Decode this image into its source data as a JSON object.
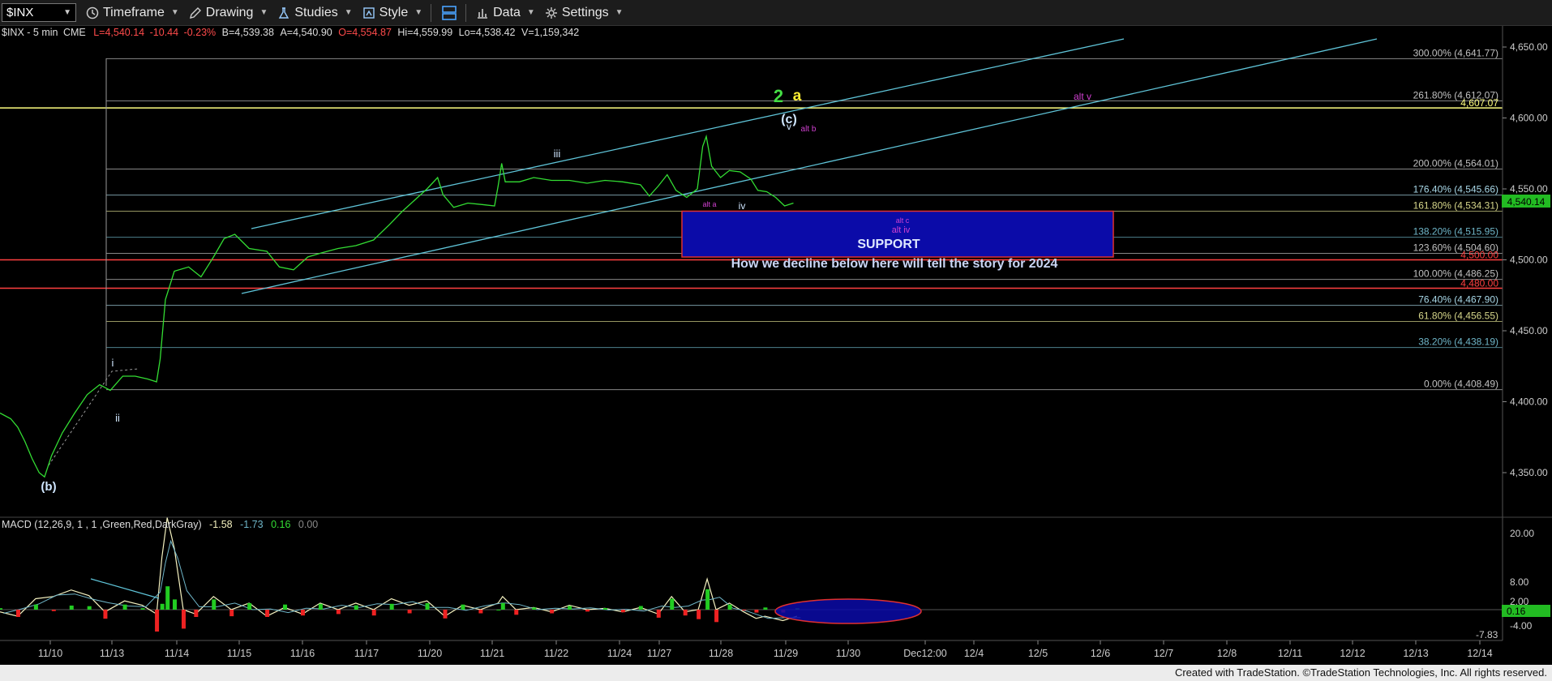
{
  "toolbar": {
    "symbol": "$INX",
    "timeframe": "Timeframe",
    "drawing": "Drawing",
    "studies": "Studies",
    "style": "Style",
    "data": "Data",
    "settings": "Settings"
  },
  "quote_line": {
    "symbol_interval": "$INX - 5 min",
    "exchange": "CME",
    "last": "L=4,540.14",
    "change": "-10.44",
    "change_pct": "-0.23%",
    "bid": "B=4,539.38",
    "ask": "A=4,540.90",
    "open": "O=4,554.87",
    "high": "Hi=4,559.99",
    "low": "Lo=4,538.42",
    "volume": "V=1,159,342"
  },
  "macd": {
    "label": "MACD (12,26,9, 1 , 1 ,Green,Red,DarkGray)",
    "v1": "-1.58",
    "v2": "-1.73",
    "v3": "0.16",
    "v4": "0.00",
    "axis": [
      "20.00",
      "8.00",
      "2.00",
      "-4.00"
    ],
    "last_tag": "0.16",
    "low_tag": "-7.83"
  },
  "footer": "Created with TradeStation. ©TradeStation Technologies, Inc. All rights reserved.",
  "chart_data": {
    "type": "line",
    "price_axis": {
      "ticks": [
        4650,
        4600,
        4550,
        4500,
        4450,
        4400,
        4350
      ],
      "labels": [
        "4,650.00",
        "4,600.00",
        "4,550.00",
        "4,500.00",
        "4,450.00",
        "4,400.00",
        "4,350.00"
      ]
    },
    "x_labels": [
      "11/10",
      "11/13",
      "11/14",
      "11/15",
      "11/16",
      "11/17",
      "11/20",
      "11/21",
      "11/22",
      "11/24",
      "11/27",
      "11/28",
      "11/29",
      "11/30",
      "Dec12:00",
      "12/4",
      "12/5",
      "12/6",
      "12/7",
      "12/8",
      "12/11",
      "12/12",
      "12/13",
      "12/14"
    ],
    "last_price": 4540.14,
    "last_price_label": "4,540.14",
    "fib_levels": [
      {
        "label": "300.00% (4,641.77)",
        "value": 4641.77,
        "color": "#c0c0c0"
      },
      {
        "label": "261.80% (4,612.07)",
        "value": 4612.07,
        "color": "#c0c0c0"
      },
      {
        "label": "200.00% (4,564.01)",
        "value": 4564.01,
        "color": "#c0c0c0"
      },
      {
        "label": "176.40% (4,545.66)",
        "value": 4545.66,
        "color": "#a9d8e8"
      },
      {
        "label": "161.80% (4,534.31)",
        "value": 4534.31,
        "color": "#d6d68a"
      },
      {
        "label": "138.20% (4,515.95)",
        "value": 4515.95,
        "color": "#6fb6c9"
      },
      {
        "label": "123.60% (4,504.60)",
        "value": 4504.6,
        "color": "#c0c0c0"
      },
      {
        "label": "100.00% (4,486.25)",
        "value": 4486.25,
        "color": "#c0c0c0"
      },
      {
        "label": "76.40% (4,467.90)",
        "value": 4467.9,
        "color": "#a9d8e8"
      },
      {
        "label": "61.80% (4,456.55)",
        "value": 4456.55,
        "color": "#d6d68a"
      },
      {
        "label": "38.20% (4,438.19)",
        "value": 4438.19,
        "color": "#6fb6c9"
      },
      {
        "label": "0.00% (4,408.49)",
        "value": 4408.49,
        "color": "#c0c0c0"
      }
    ],
    "horizontal_lines": [
      {
        "label": "4,607.07",
        "value": 4607.07,
        "color": "#ffff80"
      },
      {
        "label": "4,500.00",
        "value": 4500.0,
        "color": "#ff4040"
      },
      {
        "label": "4,480.00",
        "value": 4480.0,
        "color": "#ff4040"
      }
    ],
    "support_zone": {
      "label": "SUPPORT",
      "high": 4534.3,
      "low": 4502.0
    },
    "annotation": "How we decline below here will tell the story for 2024",
    "wave_labels": [
      {
        "text": "(b)",
        "color": "#cfe6ff"
      },
      {
        "text": "i",
        "color": "#cfe6ff"
      },
      {
        "text": "ii",
        "color": "#cfe6ff"
      },
      {
        "text": "iii",
        "color": "#cfe6ff"
      },
      {
        "text": "iv",
        "color": "#cfe6ff"
      },
      {
        "text": "v",
        "color": "#cfe6ff"
      },
      {
        "text": "(c)",
        "color": "#cfe6ff"
      },
      {
        "text": "2",
        "color": "#44dd44"
      },
      {
        "text": "a",
        "color": "#ffee33"
      },
      {
        "text": "alt b",
        "color": "#d040d0"
      },
      {
        "text": "alt a",
        "color": "#d040d0"
      },
      {
        "text": "alt c",
        "color": "#d040d0"
      },
      {
        "text": "alt iv",
        "color": "#d040d0"
      },
      {
        "text": "alt v",
        "color": "#d040d0"
      }
    ],
    "price_path": [
      [
        0,
        4392
      ],
      [
        12,
        4388
      ],
      [
        20,
        4382
      ],
      [
        28,
        4372
      ],
      [
        36,
        4360
      ],
      [
        44,
        4350
      ],
      [
        50,
        4347
      ],
      [
        58,
        4362
      ],
      [
        70,
        4378
      ],
      [
        84,
        4392
      ],
      [
        98,
        4405
      ],
      [
        112,
        4412
      ],
      [
        124,
        4408
      ],
      [
        138,
        4418
      ],
      [
        152,
        4418
      ],
      [
        166,
        4416
      ],
      [
        176,
        4414
      ],
      [
        180,
        4430
      ],
      [
        186,
        4472
      ],
      [
        196,
        4492
      ],
      [
        212,
        4495
      ],
      [
        226,
        4488
      ],
      [
        240,
        4502
      ],
      [
        252,
        4515
      ],
      [
        264,
        4518
      ],
      [
        280,
        4508
      ],
      [
        300,
        4506
      ],
      [
        314,
        4495
      ],
      [
        330,
        4493
      ],
      [
        346,
        4502
      ],
      [
        362,
        4505
      ],
      [
        380,
        4508
      ],
      [
        400,
        4510
      ],
      [
        420,
        4514
      ],
      [
        438,
        4525
      ],
      [
        452,
        4534
      ],
      [
        466,
        4542
      ],
      [
        480,
        4550
      ],
      [
        492,
        4558
      ],
      [
        498,
        4546
      ],
      [
        510,
        4537
      ],
      [
        526,
        4540
      ],
      [
        542,
        4539
      ],
      [
        556,
        4538
      ],
      [
        560,
        4552
      ],
      [
        564,
        4568
      ],
      [
        568,
        4555
      ],
      [
        584,
        4555
      ],
      [
        600,
        4558
      ],
      [
        620,
        4556
      ],
      [
        640,
        4556
      ],
      [
        660,
        4554
      ],
      [
        680,
        4556
      ],
      [
        700,
        4555
      ],
      [
        720,
        4553
      ],
      [
        730,
        4545
      ],
      [
        740,
        4552
      ],
      [
        750,
        4560
      ],
      [
        760,
        4549
      ],
      [
        772,
        4544
      ],
      [
        784,
        4550
      ],
      [
        790,
        4580
      ],
      [
        794,
        4587
      ],
      [
        800,
        4566
      ],
      [
        810,
        4558
      ],
      [
        820,
        4563
      ],
      [
        832,
        4562
      ],
      [
        844,
        4557
      ],
      [
        852,
        4549
      ],
      [
        862,
        4548
      ],
      [
        872,
        4544
      ],
      [
        882,
        4538
      ],
      [
        892,
        4540
      ]
    ],
    "macd_path": [
      [
        0,
        -0.5
      ],
      [
        20,
        -1.5
      ],
      [
        40,
        2.5
      ],
      [
        60,
        3.0
      ],
      [
        80,
        4.5
      ],
      [
        100,
        3.2
      ],
      [
        118,
        -0.5
      ],
      [
        140,
        2.0
      ],
      [
        160,
        1.0
      ],
      [
        176,
        -1.0
      ],
      [
        182,
        12.0
      ],
      [
        188,
        21.0
      ],
      [
        196,
        14.0
      ],
      [
        206,
        0.0
      ],
      [
        220,
        -1.0
      ],
      [
        240,
        3.0
      ],
      [
        260,
        0.0
      ],
      [
        280,
        1.5
      ],
      [
        300,
        -1.5
      ],
      [
        320,
        0.5
      ],
      [
        340,
        -1.0
      ],
      [
        360,
        1.5
      ],
      [
        380,
        0.0
      ],
      [
        400,
        1.5
      ],
      [
        420,
        0.0
      ],
      [
        440,
        2.5
      ],
      [
        460,
        1.0
      ],
      [
        480,
        2.0
      ],
      [
        500,
        -1.5
      ],
      [
        520,
        1.0
      ],
      [
        540,
        0.0
      ],
      [
        560,
        1.5
      ],
      [
        565,
        3.0
      ],
      [
        580,
        0.0
      ],
      [
        600,
        0.5
      ],
      [
        620,
        -0.5
      ],
      [
        640,
        1.0
      ],
      [
        660,
        0.0
      ],
      [
        680,
        0.3
      ],
      [
        700,
        -0.5
      ],
      [
        720,
        0.5
      ],
      [
        740,
        -1.0
      ],
      [
        755,
        3.0
      ],
      [
        770,
        -0.5
      ],
      [
        785,
        0.0
      ],
      [
        795,
        7.0
      ],
      [
        805,
        0.0
      ],
      [
        820,
        1.5
      ],
      [
        836,
        -0.5
      ],
      [
        850,
        -2.0
      ],
      [
        860,
        -1.5
      ],
      [
        880,
        -2.5
      ],
      [
        896,
        -1.5
      ]
    ]
  }
}
